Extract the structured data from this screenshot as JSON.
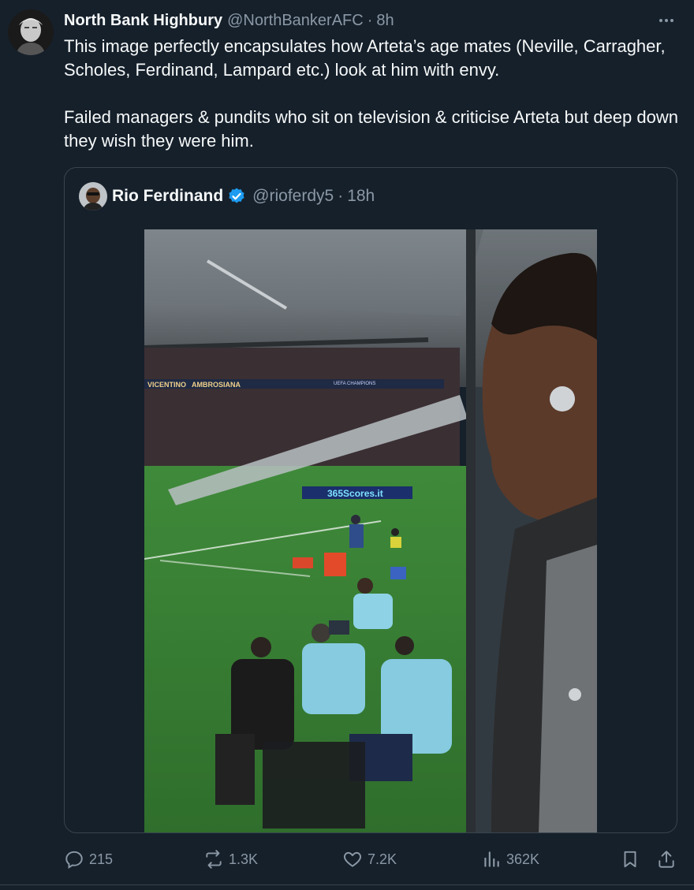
{
  "tweet": {
    "author_name": "North Bank Highbury",
    "author_handle": "@NorthBankerAFC",
    "separator": "·",
    "time": "8h",
    "text_p1": "This image perfectly encapsulates how Arteta’s age mates (Neville, Carragher, Scholes, Ferdinand, Lampard etc.) look at him with envy.",
    "text_p2": "Failed managers & pundits who sit on television & criticise Arteta but deep down they wish they were him."
  },
  "quoted": {
    "author_name": "Rio Ferdinand",
    "author_handle": "@rioferdy5",
    "separator": "·",
    "time": "18h",
    "verified": true,
    "image_signage": {
      "board_left": "VICENTINO",
      "board_mid": "AMBROSIANA",
      "board_ucl": "UEFA CHAMPIONS",
      "board_pitch": "365Scores.it"
    }
  },
  "actions": {
    "replies": "215",
    "reposts": "1.3K",
    "likes": "7.2K",
    "views": "362K"
  },
  "colors": {
    "background": "#15202b",
    "text": "#f7f9f9",
    "muted": "#8b98a5",
    "border": "#38444d",
    "verified": "#1d9bf0"
  }
}
